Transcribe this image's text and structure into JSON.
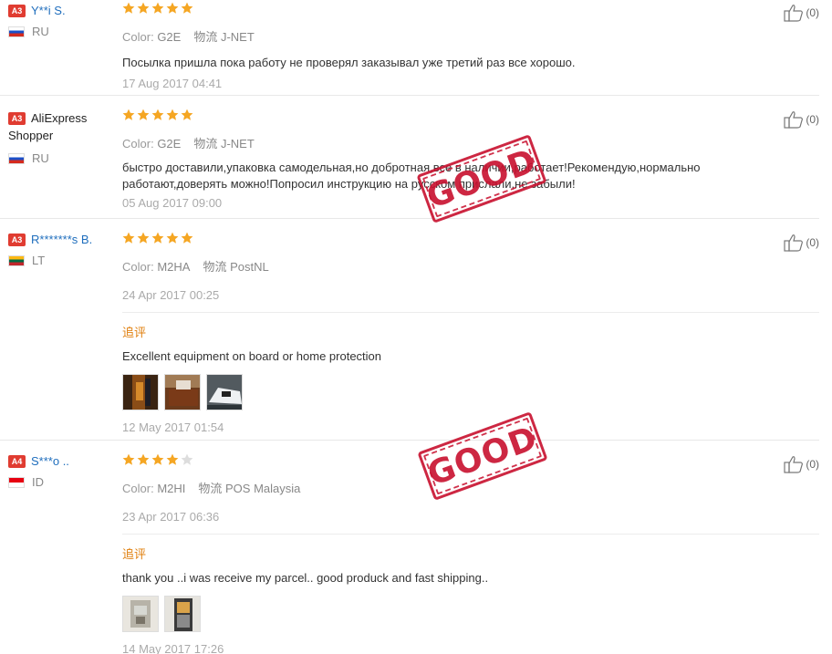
{
  "reviews": [
    {
      "level": "A3",
      "level_color": "#e03c31",
      "name": "Y**i S.",
      "country": "RU",
      "rating": 5,
      "color_label": "Color:",
      "color_value": "G2E",
      "ship_label": "物流",
      "ship_value": "J-NET",
      "text": "Посылка пришла пока работу не проверял заказывал уже третий раз все хорошо.",
      "date": "17 Aug 2017 04:41",
      "likes": "(0)"
    },
    {
      "level": "A3",
      "level_color": "#e03c31",
      "name": "AliExpress Shopper",
      "country": "RU",
      "rating": 5,
      "color_label": "Color:",
      "color_value": "G2E",
      "ship_label": "物流",
      "ship_value": "J-NET",
      "text": "быстро доставили,упаковка самодельная,но добротная,все в наличии,работает!Рекомендую,нормально работают,доверять можно!Попросил инструкцию на русском прислали,не забыли!",
      "date": "05 Aug 2017 09:00",
      "likes": "(0)"
    },
    {
      "level": "A3",
      "level_color": "#e03c31",
      "name": "R*******s B.",
      "country": "LT",
      "rating": 5,
      "color_label": "Color:",
      "color_value": "M2HA",
      "ship_label": "物流",
      "ship_value": "PostNL",
      "date": "24 Apr 2017 00:25",
      "followup_title": "追评",
      "followup_text": "Excellent equipment on board or home protection",
      "followup_date": "12 May 2017 01:54",
      "likes": "(0)"
    },
    {
      "level": "A4",
      "level_color": "#e03c31",
      "name": "S***o ..",
      "country": "ID",
      "rating": 4,
      "color_label": "Color:",
      "color_value": "M2HI",
      "ship_label": "物流",
      "ship_value": "POS Malaysia",
      "date": "23 Apr 2017 06:36",
      "followup_title": "追评",
      "followup_text": "thank you ..i was receive my parcel.. good produck and fast shipping..",
      "followup_date": "14 May 2017 17:26",
      "likes": "(0)"
    }
  ],
  "stamps": [
    "GOOD",
    "GOOD"
  ],
  "colors": {
    "star": "#f5a623",
    "star_empty": "#ddd",
    "link": "#1f6ebd",
    "followup": "#e0800f",
    "stamp": "#c8102e"
  }
}
